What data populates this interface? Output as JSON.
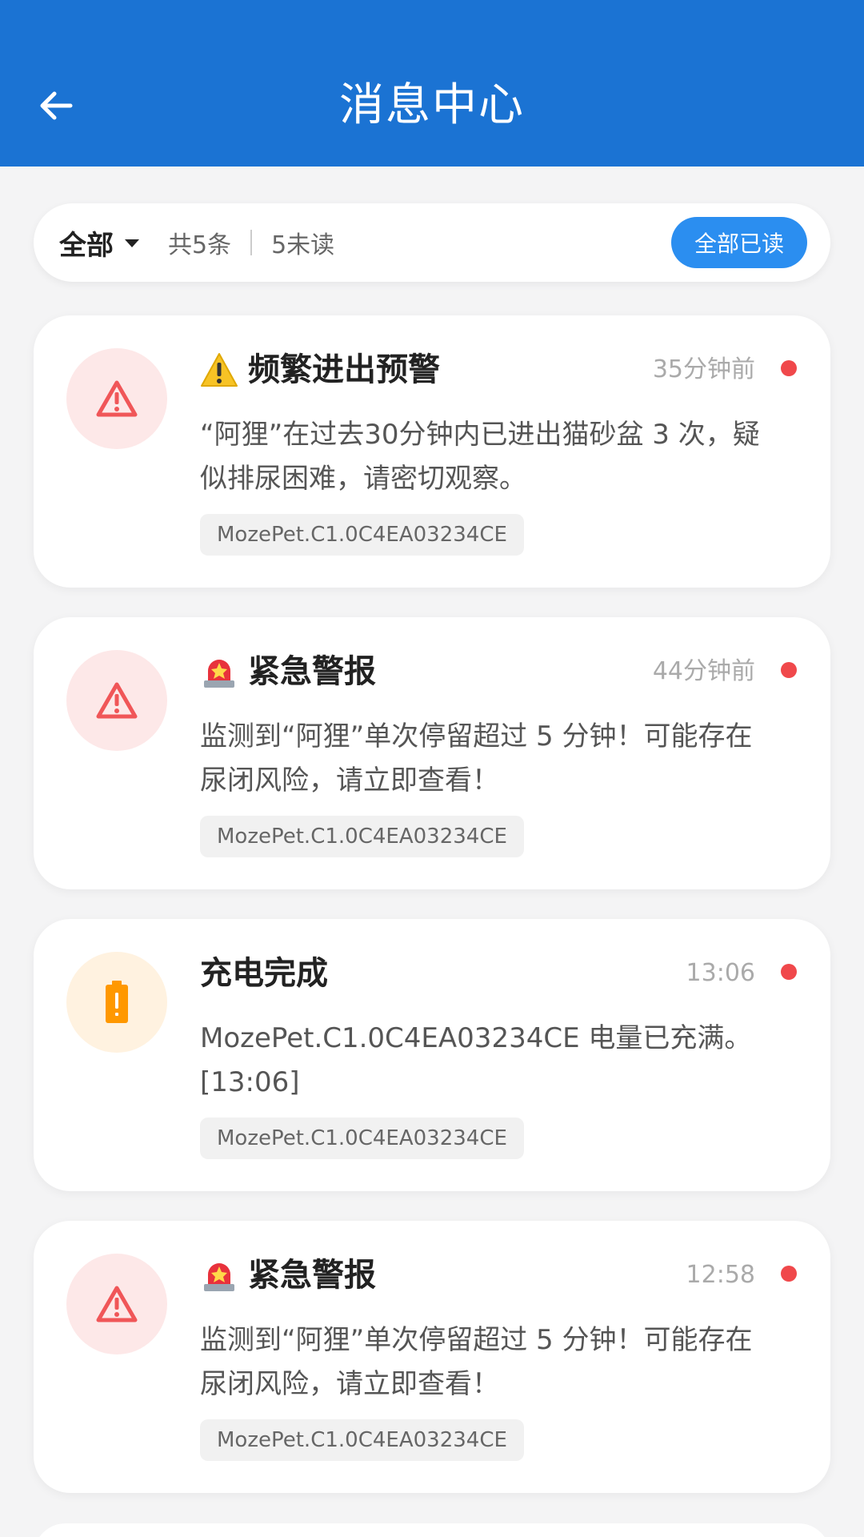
{
  "header": {
    "title": "消息中心",
    "back_icon": "arrow-left-icon"
  },
  "filter": {
    "selected": "全部",
    "total": "共5条",
    "unread": "5未读",
    "read_all_label": "全部已读"
  },
  "colors": {
    "primary": "#1b73d3",
    "button": "#2b8ef0",
    "unread_dot": "#f0484b",
    "danger": "#f05658",
    "charge": "#ff9800"
  },
  "messages": [
    {
      "title_emoji": "warning-emoji",
      "title": "频繁进出预警",
      "time": "35分钟前",
      "body": "“阿狸”在过去30分钟内已进出猫砂盆 3 次，疑似排尿困难，请密切观察。",
      "device": "MozePet.C1.0C4EA03234CE",
      "icon": "warning-triangle-icon",
      "unread": true
    },
    {
      "title_emoji": "siren-emoji",
      "title": "紧急警报",
      "time": "44分钟前",
      "body": "监测到“阿狸”单次停留超过 5 分钟！可能存在尿闭风险，请立即查看！",
      "device": "MozePet.C1.0C4EA03234CE",
      "icon": "warning-triangle-icon",
      "unread": true
    },
    {
      "title_emoji": "",
      "title": "充电完成",
      "time": "13:06",
      "body": "MozePet.C1.0C4EA03234CE 电量已充满。 [13:06]",
      "device": "MozePet.C1.0C4EA03234CE",
      "icon": "battery-alert-icon",
      "unread": true
    },
    {
      "title_emoji": "siren-emoji",
      "title": "紧急警报",
      "time": "12:58",
      "body": "监测到“阿狸”单次停留超过 5 分钟！可能存在尿闭风险，请立即查看！",
      "device": "MozePet.C1.0C4EA03234CE",
      "icon": "warning-triangle-icon",
      "unread": true
    }
  ]
}
